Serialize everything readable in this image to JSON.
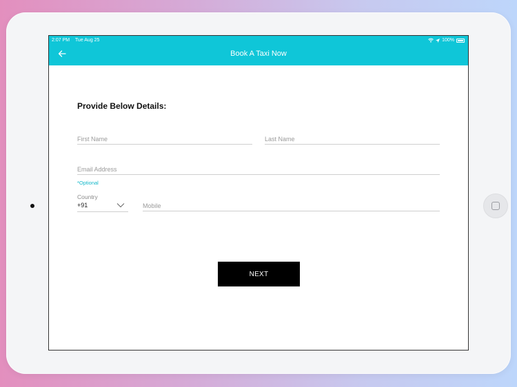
{
  "status_bar": {
    "time": "2:07 PM",
    "date": "Tue Aug 25",
    "battery": "100%"
  },
  "app_bar": {
    "title": "Book A Taxi Now",
    "back_icon": "arrow-left-icon"
  },
  "form": {
    "heading": "Provide Below Details:",
    "first_name": {
      "value": "",
      "placeholder": "First Name"
    },
    "last_name": {
      "value": "",
      "placeholder": "Last Name"
    },
    "email": {
      "value": "",
      "placeholder": "Email Address"
    },
    "email_note": "*Optional",
    "country": {
      "label": "Country",
      "value": "+91"
    },
    "mobile": {
      "value": "",
      "placeholder": "Mobile"
    },
    "next_label": "NEXT"
  },
  "colors": {
    "accent": "#0fc6d8",
    "button": "#000000",
    "optional_text": "#10b7c9"
  }
}
